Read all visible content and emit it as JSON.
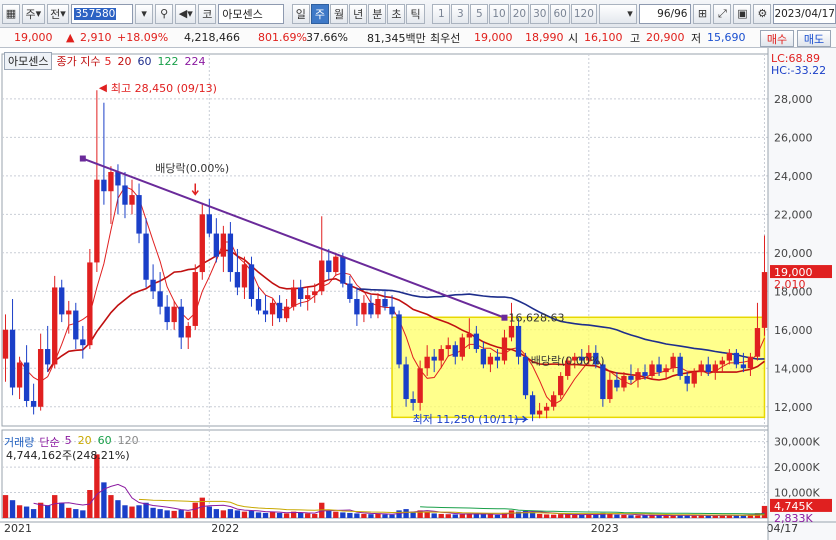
{
  "toolbar": {
    "chart_type_label": "주",
    "all_label": "전",
    "stock_code": "357580",
    "market_label": "코",
    "stock_name": "아모센스",
    "periods": [
      "일",
      "주",
      "월",
      "년",
      "분",
      "초",
      "틱"
    ],
    "active_period": "주",
    "interval_numbers": [
      "1",
      "3",
      "5",
      "10",
      "20",
      "30",
      "60",
      "120"
    ],
    "count": "96/96",
    "date": "2023/04/17"
  },
  "quote": {
    "price": "19,000",
    "change_arrow": "▲",
    "change": "2,910",
    "change_pct": "+18.09%",
    "volume": "4,218,466",
    "volume_ratio": "801.69%",
    "turnover_pct": "37.66%",
    "trade_value": "81,345백만",
    "best_ask_label": "최우선",
    "best_ask": "19,000",
    "best_bid": "18,990",
    "open_label": "시",
    "open": "16,100",
    "high_label": "고",
    "high": "20,900",
    "low_label": "저",
    "low": "15,690",
    "buy_label": "매수",
    "sell_label": "매도"
  },
  "price_panel": {
    "stock_tab": "아모센스",
    "ma_legend": {
      "prefix": "종가 지수",
      "periods": [
        "5",
        "20",
        "60",
        "122",
        "224"
      ],
      "colors": [
        "#e02020",
        "#c01010",
        "#1e2e8c",
        "#1aa04a",
        "#8b1aa0"
      ]
    },
    "lc_label": "LC:68.89",
    "hc_label": "HC:-33.22",
    "annotations": {
      "high": "최고 28,450 (09/13)",
      "low": "최저 11,250 (10/11)",
      "dividend1": "배당락(0.00%)",
      "dividend2": "배당락(0.00%)",
      "line_end": "16,628.63"
    },
    "price_tag": "19,000",
    "change_tag": "2,010"
  },
  "volume_panel": {
    "legend_title": "거래량",
    "legend_mode": "단순",
    "ma_periods": [
      "5",
      "20",
      "60",
      "120"
    ],
    "ma_colors": [
      "#8b1aa0",
      "#c8a800",
      "#1aa04a",
      "#888888"
    ],
    "last_volume": "4,744,162주(248.21%)",
    "volume_tag": "4,745K",
    "ma_tag": "2,833K"
  },
  "colors": {
    "up": "#e02020",
    "down": "#1a3fc8",
    "highlight": "#ffff66",
    "trendline": "#6a2a9a"
  },
  "chart_data": {
    "type": "candlestick",
    "unit": "KRW",
    "interval": "weekly",
    "price_axis": {
      "ylim": [
        11000,
        29500
      ],
      "ticks": [
        12000,
        14000,
        16000,
        18000,
        20000,
        22000,
        24000,
        26000,
        28000
      ],
      "tick_labels": [
        "12,000",
        "14,000",
        "16,000",
        "18,000",
        "20,000",
        "22,000",
        "24,000",
        "26,000",
        "28,000"
      ]
    },
    "volume_axis": {
      "ylim": [
        0,
        33000
      ],
      "ticks": [
        10000,
        20000,
        30000
      ],
      "tick_labels": [
        "10,000K",
        "20,000K",
        "30,000K"
      ]
    },
    "x_labels": [
      {
        "index": 0,
        "label": "2021"
      },
      {
        "index": 29.5,
        "label": "2022"
      },
      {
        "index": 83.5,
        "label": "2023"
      },
      {
        "index": 108.5,
        "label": "04/17"
      }
    ],
    "candles": [
      [
        14500,
        16800,
        13300,
        16000,
        9000
      ],
      [
        16000,
        17600,
        12600,
        13000,
        7000
      ],
      [
        13000,
        14600,
        12400,
        14300,
        5000
      ],
      [
        14300,
        15200,
        12000,
        12300,
        4500
      ],
      [
        12300,
        13200,
        11600,
        12000,
        3500
      ],
      [
        12000,
        15800,
        11800,
        15000,
        6000
      ],
      [
        15000,
        16200,
        13800,
        14200,
        5000
      ],
      [
        14200,
        18800,
        14000,
        18200,
        9000
      ],
      [
        18200,
        18600,
        16400,
        16800,
        6000
      ],
      [
        16800,
        17500,
        15800,
        17000,
        4000
      ],
      [
        17000,
        17400,
        15000,
        15500,
        3500
      ],
      [
        15500,
        16200,
        14500,
        15200,
        3000
      ],
      [
        15200,
        20200,
        15000,
        19500,
        11000
      ],
      [
        19500,
        28450,
        19000,
        23800,
        25000
      ],
      [
        23800,
        27800,
        22500,
        23200,
        14000
      ],
      [
        23200,
        24500,
        21500,
        24200,
        9000
      ],
      [
        24200,
        24600,
        22000,
        23500,
        7000
      ],
      [
        23500,
        24200,
        21800,
        22500,
        5000
      ],
      [
        22500,
        23800,
        22000,
        23000,
        4500
      ],
      [
        23000,
        23600,
        20500,
        21000,
        5000
      ],
      [
        21000,
        21800,
        18200,
        18600,
        6000
      ],
      [
        18600,
        19400,
        17600,
        18000,
        4000
      ],
      [
        18000,
        19000,
        16800,
        17200,
        3500
      ],
      [
        17200,
        17800,
        16000,
        16400,
        3000
      ],
      [
        16400,
        17500,
        16000,
        17200,
        2800
      ],
      [
        17200,
        17600,
        15000,
        15600,
        3200
      ],
      [
        15600,
        16400,
        15000,
        16200,
        2500
      ],
      [
        16200,
        19400,
        16000,
        19000,
        6000
      ],
      [
        19000,
        22600,
        18600,
        22000,
        8000
      ],
      [
        22000,
        22800,
        20800,
        21000,
        4500
      ],
      [
        21000,
        21800,
        19500,
        19800,
        3500
      ],
      [
        19800,
        21400,
        19000,
        21000,
        3000
      ],
      [
        21000,
        21600,
        18500,
        19000,
        3500
      ],
      [
        19000,
        20200,
        17800,
        18200,
        3000
      ],
      [
        18200,
        19800,
        17600,
        19400,
        2500
      ],
      [
        19400,
        19800,
        17200,
        17600,
        2800
      ],
      [
        17600,
        18200,
        16800,
        17000,
        2200
      ],
      [
        17000,
        17800,
        16400,
        16800,
        2000
      ],
      [
        16800,
        17600,
        16200,
        17400,
        2500
      ],
      [
        17400,
        17800,
        16400,
        16600,
        2000
      ],
      [
        16600,
        17600,
        16400,
        17200,
        1800
      ],
      [
        17200,
        18600,
        17000,
        18200,
        2500
      ],
      [
        18200,
        18600,
        17200,
        17600,
        2000
      ],
      [
        17600,
        18200,
        17000,
        17800,
        1800
      ],
      [
        17800,
        18400,
        17400,
        18000,
        1600
      ],
      [
        18000,
        21900,
        17800,
        19600,
        6000
      ],
      [
        19600,
        20200,
        18600,
        19000,
        3000
      ],
      [
        19000,
        20000,
        18800,
        19800,
        2500
      ],
      [
        19800,
        20000,
        18200,
        18400,
        2200
      ],
      [
        18400,
        18800,
        17400,
        17600,
        2000
      ],
      [
        17600,
        18200,
        16200,
        16800,
        1800
      ],
      [
        16800,
        17800,
        16400,
        17400,
        1600
      ],
      [
        17400,
        17800,
        16600,
        16800,
        1500
      ],
      [
        16800,
        17900,
        16600,
        17600,
        1700
      ],
      [
        17600,
        18100,
        17000,
        17200,
        1400
      ],
      [
        17200,
        17800,
        16600,
        16800,
        1300
      ],
      [
        16800,
        17000,
        14000,
        14200,
        3000
      ],
      [
        14200,
        14600,
        12000,
        12400,
        3500
      ],
      [
        12400,
        12800,
        11800,
        12200,
        2500
      ],
      [
        12200,
        14400,
        11800,
        14000,
        3000
      ],
      [
        14000,
        15200,
        13600,
        14600,
        2500
      ],
      [
        14600,
        15000,
        13800,
        14400,
        1800
      ],
      [
        14400,
        15200,
        14000,
        15000,
        1600
      ],
      [
        15000,
        15600,
        14600,
        15200,
        1500
      ],
      [
        15200,
        15400,
        14200,
        14600,
        1400
      ],
      [
        14600,
        15800,
        14400,
        15600,
        1500
      ],
      [
        15600,
        16600,
        15000,
        15800,
        1800
      ],
      [
        15800,
        16200,
        14800,
        15000,
        1600
      ],
      [
        15000,
        15400,
        14000,
        14200,
        1500
      ],
      [
        14200,
        14800,
        13800,
        14600,
        1400
      ],
      [
        14600,
        15000,
        14000,
        14400,
        1200
      ],
      [
        14400,
        16000,
        14200,
        15600,
        2000
      ],
      [
        15600,
        17400,
        15400,
        16200,
        3000
      ],
      [
        16200,
        16600,
        14200,
        14600,
        2500
      ],
      [
        14600,
        14800,
        12400,
        12600,
        2800
      ],
      [
        12600,
        12800,
        11250,
        11600,
        2500
      ],
      [
        11600,
        12200,
        11400,
        11800,
        1600
      ],
      [
        11800,
        12200,
        11400,
        12000,
        1400
      ],
      [
        12000,
        12800,
        11800,
        12600,
        1300
      ],
      [
        12600,
        13800,
        12400,
        13600,
        1500
      ],
      [
        13600,
        14600,
        13400,
        14400,
        1400
      ],
      [
        14400,
        14800,
        14000,
        14600,
        1200
      ],
      [
        14600,
        15000,
        14200,
        14400,
        1300
      ],
      [
        14400,
        15200,
        14200,
        14800,
        1500
      ],
      [
        14800,
        15200,
        14000,
        14200,
        1400
      ],
      [
        14200,
        14400,
        12000,
        12400,
        2000
      ],
      [
        12400,
        13800,
        12200,
        13400,
        1800
      ],
      [
        13400,
        13800,
        12800,
        13000,
        1300
      ],
      [
        13000,
        13800,
        12800,
        13600,
        1200
      ],
      [
        13600,
        14200,
        13200,
        13400,
        1100
      ],
      [
        13400,
        14000,
        13000,
        13800,
        1000
      ],
      [
        13800,
        14200,
        13400,
        13600,
        1000
      ],
      [
        13600,
        14400,
        13400,
        14200,
        1100
      ],
      [
        14200,
        14600,
        13600,
        13800,
        1000
      ],
      [
        13800,
        14200,
        13400,
        14000,
        900
      ],
      [
        14000,
        14800,
        13800,
        14600,
        1200
      ],
      [
        14600,
        14800,
        13400,
        13600,
        1100
      ],
      [
        13600,
        13800,
        12800,
        13200,
        1000
      ],
      [
        13200,
        14000,
        13000,
        13800,
        900
      ],
      [
        13800,
        14400,
        13600,
        14200,
        1000
      ],
      [
        14200,
        14600,
        13600,
        13800,
        900
      ],
      [
        13800,
        14400,
        13400,
        14200,
        1000
      ],
      [
        14200,
        14600,
        13800,
        14400,
        1100
      ],
      [
        14400,
        15000,
        14200,
        14800,
        1200
      ],
      [
        14800,
        15000,
        14000,
        14200,
        1000
      ],
      [
        14200,
        14800,
        13800,
        14000,
        1100
      ],
      [
        14000,
        14800,
        13600,
        14600,
        1400
      ],
      [
        14600,
        17400,
        14400,
        16090,
        1900
      ],
      [
        16100,
        20900,
        15690,
        19000,
        4745
      ]
    ]
  }
}
